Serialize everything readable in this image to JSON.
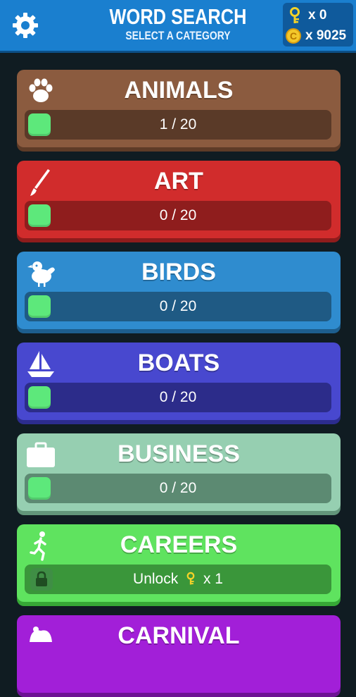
{
  "header": {
    "title": "WORD SEARCH",
    "subtitle": "SELECT A CATEGORY",
    "settings_icon": "gear-icon",
    "keys_label": "x 0",
    "coins_label": "x 9025"
  },
  "colors": {
    "background": "#101c22",
    "header": "#1a7fcf",
    "progress_fill": "#5de87b",
    "key": "#f2d228"
  },
  "categories": [
    {
      "name": "ANIMALS",
      "icon": "paw-icon",
      "progress_label": "1 / 20",
      "progress": 0.05,
      "color": "#8b5b3f",
      "shadow": "#5e3b27",
      "bar": "#5a3a28"
    },
    {
      "name": "ART",
      "icon": "paintbrush-icon",
      "progress_label": "0 / 20",
      "progress": 0,
      "color": "#d12c2c",
      "shadow": "#8e1c1c",
      "bar": "#8f1d1d"
    },
    {
      "name": "BIRDS",
      "icon": "bird-icon",
      "progress_label": "0 / 20",
      "progress": 0,
      "color": "#2f8ccf",
      "shadow": "#1d5e8e",
      "bar": "#1f5a84"
    },
    {
      "name": "BOATS",
      "icon": "sailboat-icon",
      "progress_label": "0 / 20",
      "progress": 0,
      "color": "#4848cf",
      "shadow": "#2c2c8e",
      "bar": "#2c2c8a"
    },
    {
      "name": "BUSINESS",
      "icon": "briefcase-icon",
      "progress_label": "0 / 20",
      "progress": 0,
      "color": "#96cfb1",
      "shadow": "#62967a",
      "bar": "#5c8a72"
    },
    {
      "name": "CAREERS",
      "icon": "runner-icon",
      "unlock_label": "Unlock",
      "unlock_cost": "x 1",
      "locked": true,
      "color": "#5fe35f",
      "shadow": "#36a836",
      "bar": "#3a963a"
    },
    {
      "name": "CARNIVAL",
      "icon": "carnival-icon",
      "color": "#a21fd8",
      "shadow": "#6d1394"
    }
  ]
}
